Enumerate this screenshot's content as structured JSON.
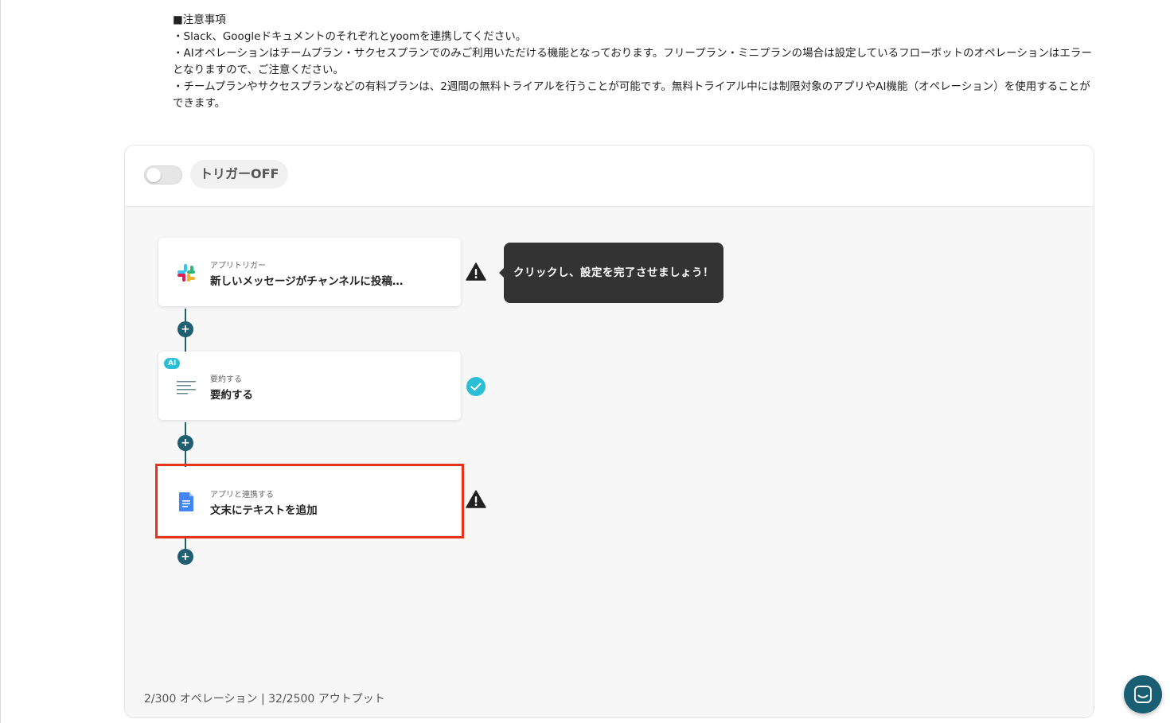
{
  "notice": {
    "heading": "■注意事項",
    "lines": [
      "・Slack、Googleドキュメントのそれぞれとyoomを連携してください。",
      "・AIオペレーションはチームプラン・サクセスプランでのみご利用いただける機能となっております。フリープラン・ミニプランの場合は設定しているフローボットのオペレーションはエラーとなりますので、ご注意ください。",
      "・チームプランやサクセスプランなどの有料プランは、2週間の無料トライアルを行うことが可能です。無料トライアル中には制限対象のアプリやAI機能（オペレーション）を使用することができます。"
    ]
  },
  "flow": {
    "trigger_label": "トリガーOFF",
    "trigger_enabled": false,
    "steps": [
      {
        "sub": "アプリトリガー",
        "title": "新しいメッセージがチャンネルに投稿…",
        "icon": "slack-icon",
        "status": "warning"
      },
      {
        "sub": "要約する",
        "title": "要約する",
        "icon": "summary-lines-icon",
        "badge": "AI",
        "status": "complete"
      },
      {
        "sub": "アプリと連携する",
        "title": "文末にテキストを追加",
        "icon": "google-docs-icon",
        "status": "warning",
        "selected": true
      }
    ],
    "tooltip": "クリックし、設定を完了させましょう！",
    "usage": "2/300 オペレーション | 32/2500 アウトプット"
  },
  "colors": {
    "connector": "#1f5f72",
    "highlight": "#e8331c",
    "complete": "#2bbfd6",
    "chat_button": "#1a5e73"
  }
}
